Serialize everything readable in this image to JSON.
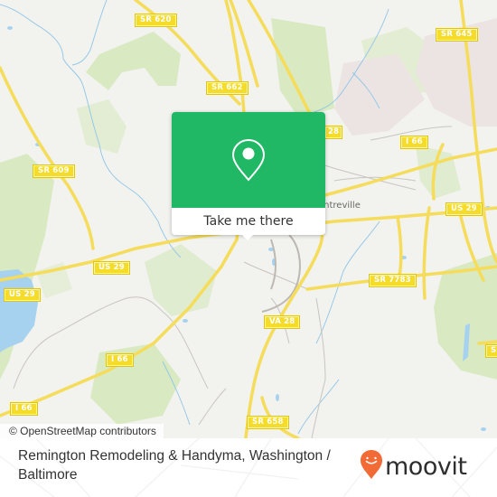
{
  "map": {
    "road_labels": [
      "SR 620",
      "SR 645",
      "SR 662",
      "28",
      "I 66",
      "I 66",
      "SR 609",
      "US 29",
      "US 29",
      "US 29",
      "SR 7783",
      "VA 28",
      "I 66",
      "I 66",
      "SR 658",
      "SR"
    ],
    "town_label": "Centreville",
    "attribution": "© OpenStreetMap contributors"
  },
  "popup": {
    "icon": "map-pin-icon",
    "button_label": "Take me there",
    "color": "#21b865"
  },
  "footer": {
    "title": "Remington Remodeling & Handyma, Washington / Baltimore",
    "brand": "moovit",
    "brand_color": "#f26a36"
  }
}
